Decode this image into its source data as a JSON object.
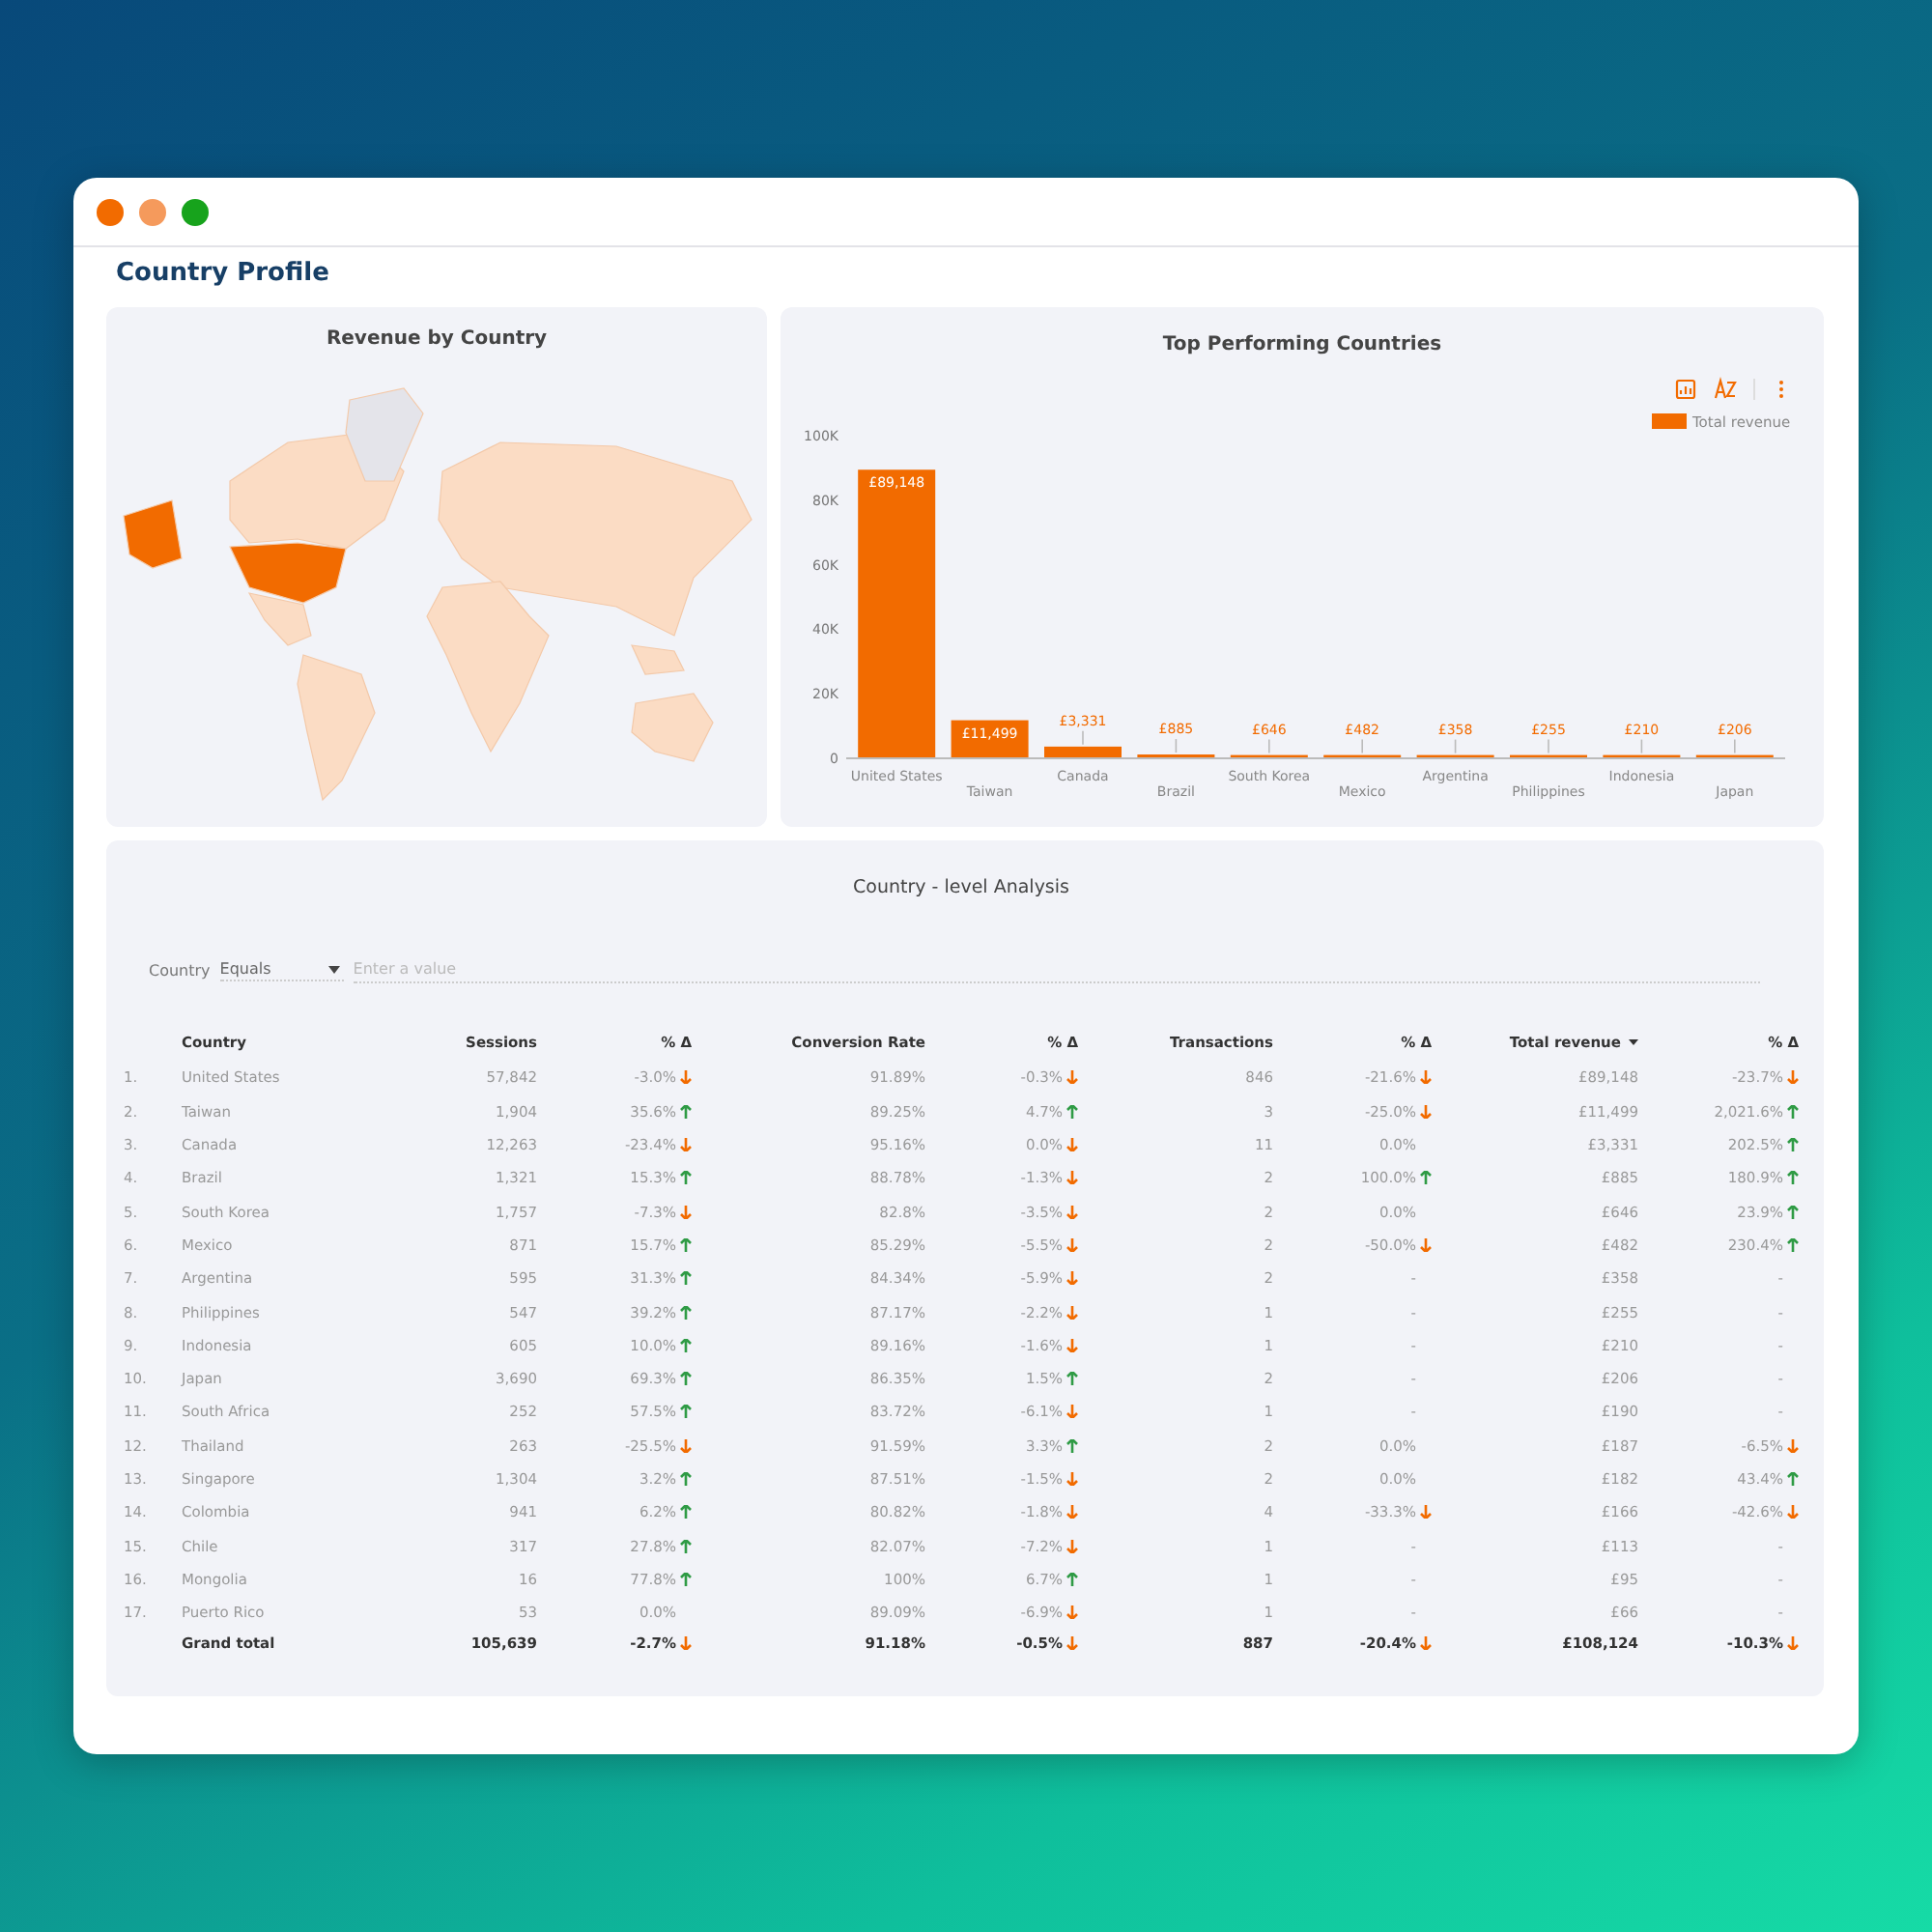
{
  "window": {
    "controls": [
      {
        "color": "#f26b00"
      },
      {
        "color": "#f59a5c"
      },
      {
        "color": "#17a31c"
      }
    ]
  },
  "page_title": "Country Profile",
  "map": {
    "title": "Revenue by Country"
  },
  "chart": {
    "title": "Top Performing Countries",
    "chart_data": {
      "type": "bar",
      "categories": [
        "United States",
        "Taiwan",
        "Canada",
        "Brazil",
        "South Korea",
        "Mexico",
        "Argentina",
        "Philippines",
        "Indonesia",
        "Japan"
      ],
      "series": [
        {
          "name": "Total revenue",
          "color": "#f26b00",
          "values": [
            89148,
            11499,
            3331,
            885,
            646,
            482,
            358,
            255,
            210,
            206
          ]
        }
      ],
      "ylim": [
        0,
        100000
      ],
      "yticks": [
        {
          "value": 0,
          "label": "0"
        },
        {
          "value": 20000,
          "label": "20K"
        },
        {
          "value": 40000,
          "label": "40K"
        },
        {
          "value": 60000,
          "label": "60K"
        },
        {
          "value": 80000,
          "label": "80K"
        },
        {
          "value": 100000,
          "label": "100K"
        }
      ],
      "value_labels": [
        "£89,148",
        "£11,499",
        "£3,331",
        "£885",
        "£646",
        "£482",
        "£358",
        "£255",
        "£210",
        "£206"
      ]
    }
  },
  "table": {
    "title": "Country - level Analysis",
    "filter": {
      "field": "Country",
      "operator": "Equals",
      "placeholder": "Enter a value"
    },
    "columns": [
      {
        "label": "Country",
        "sorted": false
      },
      {
        "label": "Sessions",
        "sorted": false
      },
      {
        "label": "% Δ",
        "sorted": false
      },
      {
        "label": "Conversion Rate",
        "sorted": false
      },
      {
        "label": "% Δ",
        "sorted": false
      },
      {
        "label": "Transactions",
        "sorted": false
      },
      {
        "label": "% Δ",
        "sorted": false
      },
      {
        "label": "Total revenue",
        "sorted": true
      },
      {
        "label": "% Δ",
        "sorted": false
      }
    ],
    "rows": [
      {
        "index": "1.",
        "country": "United States",
        "sessions": "57,842",
        "sessions_change": {
          "text": "-3.0%",
          "kind": "down"
        },
        "conversion_rate": "91.89%",
        "conversion_rate_change": {
          "text": "-0.3%",
          "kind": "down"
        },
        "transactions": "846",
        "transactions_change": {
          "text": "-21.6%",
          "kind": "down"
        },
        "revenue": "£89,148",
        "revenue_change": {
          "text": "-23.7%",
          "kind": "down"
        }
      },
      {
        "index": "2.",
        "country": "Taiwan",
        "sessions": "1,904",
        "sessions_change": {
          "text": "35.6%",
          "kind": "up"
        },
        "conversion_rate": "89.25%",
        "conversion_rate_change": {
          "text": "4.7%",
          "kind": "up"
        },
        "transactions": "3",
        "transactions_change": {
          "text": "-25.0%",
          "kind": "down"
        },
        "revenue": "£11,499",
        "revenue_change": {
          "text": "2,021.6%",
          "kind": "up"
        }
      },
      {
        "index": "3.",
        "country": "Canada",
        "sessions": "12,263",
        "sessions_change": {
          "text": "-23.4%",
          "kind": "down"
        },
        "conversion_rate": "95.16%",
        "conversion_rate_change": {
          "text": "0.0%",
          "kind": "down"
        },
        "transactions": "11",
        "transactions_change": {
          "text": "0.0%",
          "kind": "plain"
        },
        "revenue": "£3,331",
        "revenue_change": {
          "text": "202.5%",
          "kind": "up"
        }
      },
      {
        "index": "4.",
        "country": "Brazil",
        "sessions": "1,321",
        "sessions_change": {
          "text": "15.3%",
          "kind": "up"
        },
        "conversion_rate": "88.78%",
        "conversion_rate_change": {
          "text": "-1.3%",
          "kind": "down"
        },
        "transactions": "2",
        "transactions_change": {
          "text": "100.0%",
          "kind": "up"
        },
        "revenue": "£885",
        "revenue_change": {
          "text": "180.9%",
          "kind": "up"
        }
      },
      {
        "index": "5.",
        "country": "South Korea",
        "sessions": "1,757",
        "sessions_change": {
          "text": "-7.3%",
          "kind": "down"
        },
        "conversion_rate": "82.8%",
        "conversion_rate_change": {
          "text": "-3.5%",
          "kind": "down"
        },
        "transactions": "2",
        "transactions_change": {
          "text": "0.0%",
          "kind": "plain"
        },
        "revenue": "£646",
        "revenue_change": {
          "text": "23.9%",
          "kind": "up"
        }
      },
      {
        "index": "6.",
        "country": "Mexico",
        "sessions": "871",
        "sessions_change": {
          "text": "15.7%",
          "kind": "up"
        },
        "conversion_rate": "85.29%",
        "conversion_rate_change": {
          "text": "-5.5%",
          "kind": "down"
        },
        "transactions": "2",
        "transactions_change": {
          "text": "-50.0%",
          "kind": "down"
        },
        "revenue": "£482",
        "revenue_change": {
          "text": "230.4%",
          "kind": "up"
        }
      },
      {
        "index": "7.",
        "country": "Argentina",
        "sessions": "595",
        "sessions_change": {
          "text": "31.3%",
          "kind": "up"
        },
        "conversion_rate": "84.34%",
        "conversion_rate_change": {
          "text": "-5.9%",
          "kind": "down"
        },
        "transactions": "2",
        "transactions_change": {
          "text": "-",
          "kind": "plain"
        },
        "revenue": "£358",
        "revenue_change": {
          "text": "-",
          "kind": "plain"
        }
      },
      {
        "index": "8.",
        "country": "Philippines",
        "sessions": "547",
        "sessions_change": {
          "text": "39.2%",
          "kind": "up"
        },
        "conversion_rate": "87.17%",
        "conversion_rate_change": {
          "text": "-2.2%",
          "kind": "down"
        },
        "transactions": "1",
        "transactions_change": {
          "text": "-",
          "kind": "plain"
        },
        "revenue": "£255",
        "revenue_change": {
          "text": "-",
          "kind": "plain"
        }
      },
      {
        "index": "9.",
        "country": "Indonesia",
        "sessions": "605",
        "sessions_change": {
          "text": "10.0%",
          "kind": "up"
        },
        "conversion_rate": "89.16%",
        "conversion_rate_change": {
          "text": "-1.6%",
          "kind": "down"
        },
        "transactions": "1",
        "transactions_change": {
          "text": "-",
          "kind": "plain"
        },
        "revenue": "£210",
        "revenue_change": {
          "text": "-",
          "kind": "plain"
        }
      },
      {
        "index": "10.",
        "country": "Japan",
        "sessions": "3,690",
        "sessions_change": {
          "text": "69.3%",
          "kind": "up"
        },
        "conversion_rate": "86.35%",
        "conversion_rate_change": {
          "text": "1.5%",
          "kind": "up"
        },
        "transactions": "2",
        "transactions_change": {
          "text": "-",
          "kind": "plain"
        },
        "revenue": "£206",
        "revenue_change": {
          "text": "-",
          "kind": "plain"
        }
      },
      {
        "index": "11.",
        "country": "South Africa",
        "sessions": "252",
        "sessions_change": {
          "text": "57.5%",
          "kind": "up"
        },
        "conversion_rate": "83.72%",
        "conversion_rate_change": {
          "text": "-6.1%",
          "kind": "down"
        },
        "transactions": "1",
        "transactions_change": {
          "text": "-",
          "kind": "plain"
        },
        "revenue": "£190",
        "revenue_change": {
          "text": "-",
          "kind": "plain"
        }
      },
      {
        "index": "12.",
        "country": "Thailand",
        "sessions": "263",
        "sessions_change": {
          "text": "-25.5%",
          "kind": "down"
        },
        "conversion_rate": "91.59%",
        "conversion_rate_change": {
          "text": "3.3%",
          "kind": "up"
        },
        "transactions": "2",
        "transactions_change": {
          "text": "0.0%",
          "kind": "plain"
        },
        "revenue": "£187",
        "revenue_change": {
          "text": "-6.5%",
          "kind": "down"
        }
      },
      {
        "index": "13.",
        "country": "Singapore",
        "sessions": "1,304",
        "sessions_change": {
          "text": "3.2%",
          "kind": "up"
        },
        "conversion_rate": "87.51%",
        "conversion_rate_change": {
          "text": "-1.5%",
          "kind": "down"
        },
        "transactions": "2",
        "transactions_change": {
          "text": "0.0%",
          "kind": "plain"
        },
        "revenue": "£182",
        "revenue_change": {
          "text": "43.4%",
          "kind": "up"
        }
      },
      {
        "index": "14.",
        "country": "Colombia",
        "sessions": "941",
        "sessions_change": {
          "text": "6.2%",
          "kind": "up"
        },
        "conversion_rate": "80.82%",
        "conversion_rate_change": {
          "text": "-1.8%",
          "kind": "down"
        },
        "transactions": "4",
        "transactions_change": {
          "text": "-33.3%",
          "kind": "down"
        },
        "revenue": "£166",
        "revenue_change": {
          "text": "-42.6%",
          "kind": "down"
        }
      },
      {
        "index": "15.",
        "country": "Chile",
        "sessions": "317",
        "sessions_change": {
          "text": "27.8%",
          "kind": "up"
        },
        "conversion_rate": "82.07%",
        "conversion_rate_change": {
          "text": "-7.2%",
          "kind": "down"
        },
        "transactions": "1",
        "transactions_change": {
          "text": "-",
          "kind": "plain"
        },
        "revenue": "£113",
        "revenue_change": {
          "text": "-",
          "kind": "plain"
        }
      },
      {
        "index": "16.",
        "country": "Mongolia",
        "sessions": "16",
        "sessions_change": {
          "text": "77.8%",
          "kind": "up"
        },
        "conversion_rate": "100%",
        "conversion_rate_change": {
          "text": "6.7%",
          "kind": "up"
        },
        "transactions": "1",
        "transactions_change": {
          "text": "-",
          "kind": "plain"
        },
        "revenue": "£95",
        "revenue_change": {
          "text": "-",
          "kind": "plain"
        }
      },
      {
        "index": "17.",
        "country": "Puerto Rico",
        "sessions": "53",
        "sessions_change": {
          "text": "0.0%",
          "kind": "plain"
        },
        "conversion_rate": "89.09%",
        "conversion_rate_change": {
          "text": "-6.9%",
          "kind": "down"
        },
        "transactions": "1",
        "transactions_change": {
          "text": "-",
          "kind": "plain"
        },
        "revenue": "£66",
        "revenue_change": {
          "text": "-",
          "kind": "plain"
        }
      }
    ],
    "total": {
      "country": "Grand total",
      "sessions": "105,639",
      "sessions_change": {
        "text": "-2.7%",
        "kind": "down"
      },
      "conversion_rate": "91.18%",
      "conversion_rate_change": {
        "text": "-0.5%",
        "kind": "down"
      },
      "transactions": "887",
      "transactions_change": {
        "text": "-20.4%",
        "kind": "down"
      },
      "revenue": "£108,124",
      "revenue_change": {
        "text": "-10.3%",
        "kind": "down"
      }
    }
  }
}
